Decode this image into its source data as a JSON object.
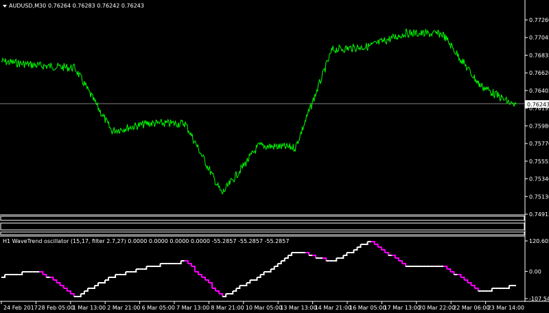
{
  "chart": {
    "symbol_timeframe": "AUDUSD,M30",
    "ohlc_text": "0.76264 0.76283 0.76242 0.76243",
    "current_price": "0.76243",
    "collapse_icon": "triangle-down-icon"
  },
  "price_axis": {
    "ticks": [
      "0.77260",
      "0.77045",
      "0.76835",
      "0.76620",
      "0.76405",
      "0.76195",
      "0.75980",
      "0.75770",
      "0.75555",
      "0.75340",
      "0.75130",
      "0.74915"
    ]
  },
  "indicator": {
    "title": "H1 WaveTrend oscillator (15,17, filter 2.7,27) 0.0000 0.0000 0.0000 0.0000 -55.2857 -55.2857 -55.2857",
    "ticks": [
      "120.6057",
      "0.00",
      "-107.5409"
    ]
  },
  "time_axis": {
    "ticks": [
      "24 Feb 2017",
      "28 Feb 05:00",
      "1 Mar 13:00",
      "2 Mar 21:00",
      "6 Mar 05:00",
      "7 Mar 13:00",
      "8 Mar 21:00",
      "10 Mar 05:00",
      "13 Mar 13:00",
      "14 Mar 21:00",
      "16 Mar 05:00",
      "17 Mar 13:00",
      "20 Mar 22:00",
      "22 Mar 06:00",
      "23 Mar 14:00"
    ]
  },
  "colors": {
    "background": "#000000",
    "price_line": "#00ff00",
    "osc_up": "#ffffff",
    "osc_down": "#ff00ff",
    "axis": "#ffffff",
    "current_line": "#808080"
  },
  "chart_data": [
    {
      "type": "line",
      "title": "AUDUSD,M30",
      "x": [
        "24 Feb 2017",
        "28 Feb 05:00",
        "1 Mar 13:00",
        "2 Mar 21:00",
        "6 Mar 05:00",
        "7 Mar 13:00",
        "8 Mar 21:00",
        "10 Mar 05:00",
        "13 Mar 13:00",
        "14 Mar 21:00",
        "16 Mar 05:00",
        "17 Mar 13:00",
        "20 Mar 22:00",
        "22 Mar 06:00",
        "23 Mar 14:00"
      ],
      "series": [
        {
          "values": [
            0.7676,
            0.7671,
            0.7668,
            0.7592,
            0.7601,
            0.7601,
            0.7516,
            0.7574,
            0.7572,
            0.769,
            0.7694,
            0.771,
            0.7709,
            0.7648,
            0.7621
          ]
        }
      ],
      "ylim": [
        0.74915,
        0.7726
      ]
    },
    {
      "type": "line",
      "title": "H1 WaveTrend oscillator (15,17, filter 2.7,27)",
      "x": [
        "24 Feb 2017",
        "28 Feb 05:00",
        "1 Mar 13:00",
        "2 Mar 21:00",
        "6 Mar 05:00",
        "7 Mar 13:00",
        "8 Mar 21:00",
        "10 Mar 05:00",
        "13 Mar 13:00",
        "14 Mar 21:00",
        "16 Mar 05:00",
        "17 Mar 13:00",
        "20 Mar 22:00",
        "22 Mar 06:00",
        "23 Mar 14:00"
      ],
      "series": [
        {
          "values": [
            -20,
            5,
            -100,
            -20,
            20,
            40,
            -100,
            -20,
            80,
            40,
            120,
            20,
            25,
            -80,
            -55
          ]
        }
      ],
      "ylim": [
        -107.5409,
        120.6057
      ]
    }
  ]
}
